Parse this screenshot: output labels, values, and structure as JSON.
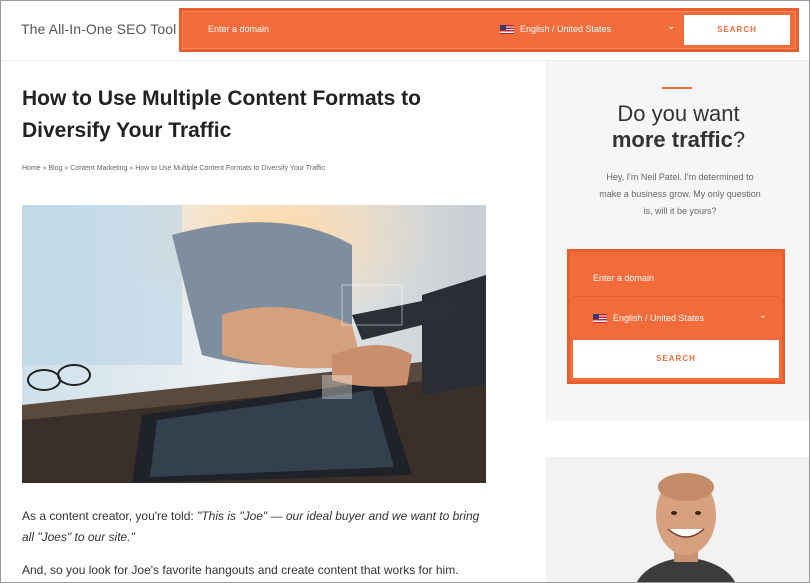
{
  "header": {
    "brand": "The All-In-One SEO Tool",
    "domain_placeholder": "Enter a domain",
    "language": "English / United States",
    "search_label": "SEARCH"
  },
  "article": {
    "title": "How to Use Multiple Content Formats to Diversify Your Traffic",
    "breadcrumbs": "Home » Blog » Content Marketing » How to Use Multiple Content Formats to Diversify Your Traffic",
    "para1_lead": "As a content creator, you're told: ",
    "para1_quote": "\"This is \"Joe\" — our ideal buyer and we want to bring all \"Joes\" to our site.\"",
    "para2": "And, so you look for Joe's favorite hangouts and create content that works for him."
  },
  "sidebar": {
    "heading_line1": "Do you want",
    "heading_bold": "more traffic",
    "heading_mark": "?",
    "text": "Hey, I'm Neil Patel. I'm determined to make a business grow. My only question is, will it be yours?",
    "domain_placeholder": "Enter a domain",
    "language": "English / United States",
    "search_label": "SEARCH"
  },
  "colors": {
    "accent": "#f26b3a"
  }
}
